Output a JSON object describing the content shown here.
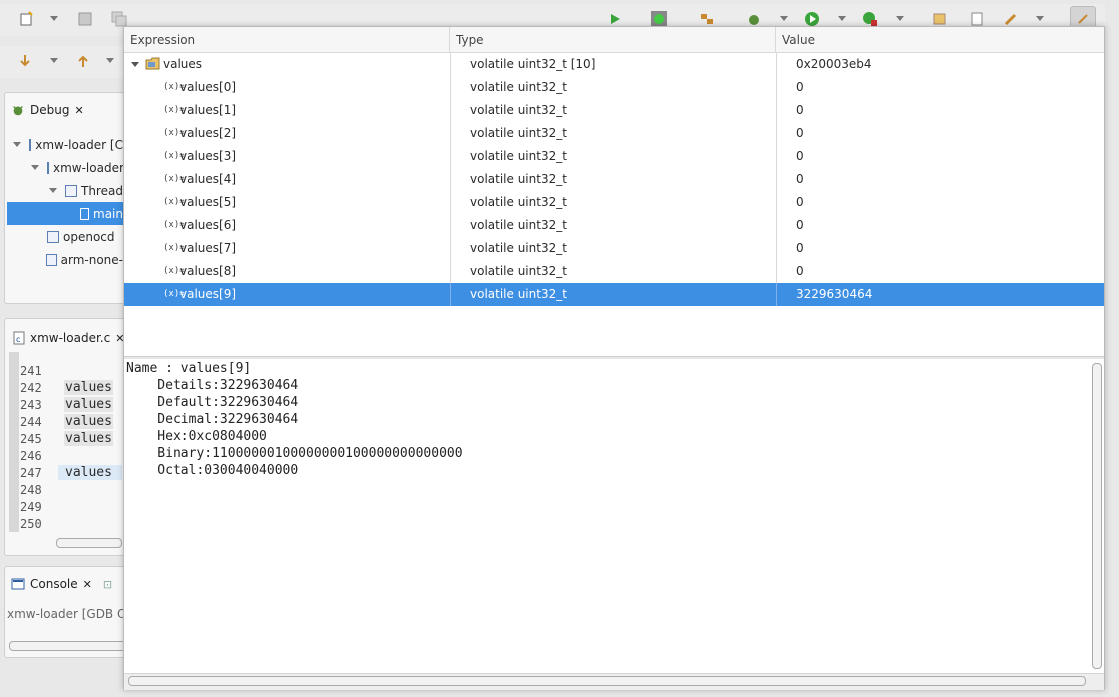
{
  "debug_view": {
    "tab_label": "Debug",
    "tree": [
      {
        "label": "xmw-loader [C",
        "icon": "c-app-icon",
        "indent": 0,
        "expanded": true
      },
      {
        "label": "xmw-loader",
        "icon": "process-icon",
        "indent": 1,
        "expanded": true
      },
      {
        "label": "Thread",
        "icon": "thread-icon",
        "indent": 2,
        "expanded": true
      },
      {
        "label": "main",
        "icon": "stack-frame-icon",
        "indent": 3,
        "selected": true
      },
      {
        "label": "openocd",
        "icon": "launcher-icon",
        "indent": 1
      },
      {
        "label": "arm-none-",
        "icon": "launcher-icon",
        "indent": 1
      }
    ]
  },
  "editor": {
    "tab_label": "xmw-loader.c",
    "line_numbers": [
      "241",
      "242",
      "243",
      "244",
      "245",
      "246",
      "247",
      "248",
      "249",
      "250"
    ],
    "code_snippets": [
      {
        "line": "242",
        "text": "values"
      },
      {
        "line": "243",
        "text": "values"
      },
      {
        "line": "244",
        "text": "values"
      },
      {
        "line": "245",
        "text": "values"
      },
      {
        "line": "247",
        "text": "values",
        "highlight": true
      }
    ]
  },
  "console": {
    "tab_label": "Console",
    "content": "xmw-loader [GDB Op"
  },
  "expressions_popup": {
    "columns": {
      "expression": "Expression",
      "type": "Type",
      "value": "Value"
    },
    "root": {
      "expression": "values",
      "type": "volatile uint32_t [10]",
      "value": "0x20003eb4"
    },
    "children": [
      {
        "expression": "values[0]",
        "type": "volatile uint32_t",
        "value": "0"
      },
      {
        "expression": "values[1]",
        "type": "volatile uint32_t",
        "value": "0"
      },
      {
        "expression": "values[2]",
        "type": "volatile uint32_t",
        "value": "0"
      },
      {
        "expression": "values[3]",
        "type": "volatile uint32_t",
        "value": "0"
      },
      {
        "expression": "values[4]",
        "type": "volatile uint32_t",
        "value": "0"
      },
      {
        "expression": "values[5]",
        "type": "volatile uint32_t",
        "value": "0"
      },
      {
        "expression": "values[6]",
        "type": "volatile uint32_t",
        "value": "0"
      },
      {
        "expression": "values[7]",
        "type": "volatile uint32_t",
        "value": "0"
      },
      {
        "expression": "values[8]",
        "type": "volatile uint32_t",
        "value": "0"
      },
      {
        "expression": "values[9]",
        "type": "volatile uint32_t",
        "value": "3229630464",
        "selected": true
      }
    ],
    "variable_icon_text": "(x)=",
    "details": [
      "Name : values[9]",
      "    Details:3229630464",
      "    Default:3229630464",
      "    Decimal:3229630464",
      "    Hex:0xc0804000",
      "    Binary:11000000100000000100000000000000",
      "    Octal:030040040000"
    ]
  },
  "colors": {
    "selection": "#3d8fe3",
    "panel_bg": "#f7f7f7",
    "header_bg": "#f6f6f6"
  }
}
